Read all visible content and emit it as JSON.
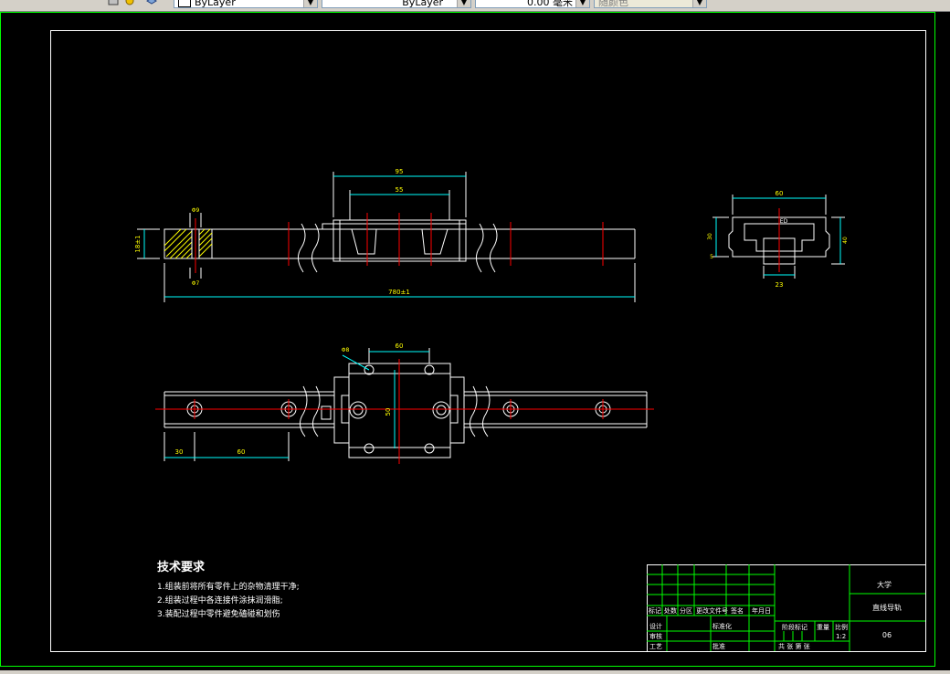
{
  "toolbar": {
    "color_combo": "ByLayer",
    "linetype_combo": "ByLayer",
    "lineweight_combo": "0.00 毫米",
    "plotstyle_combo": "随颜色"
  },
  "drawing": {
    "dims": {
      "top_outer_width": "95",
      "top_inner_width": "55",
      "rail_height": "18±1",
      "bolt_hole_dia": "Φ9",
      "bolt_hole_small": "Φ7",
      "rail_total_length": "780±1",
      "end_width": "60",
      "end_left_height": "30",
      "end_right_height": "40",
      "end_small": "5",
      "end_rail_width": "23",
      "end_label": "ED",
      "plan_width": "60",
      "plan_height": "50",
      "plan_hole": "Φ8",
      "plan_left_offset": "30",
      "plan_pitch": "60"
    },
    "tech_requirements": {
      "title": "技术要求",
      "items": [
        "1.组装前将所有零件上的杂物清理干净;",
        "2.组装过程中各连接件涂抹润滑脂;",
        "3.装配过程中零件避免磕碰和划伤"
      ]
    },
    "title_block": {
      "school": "大学",
      "part_name": "直线导轨",
      "drawing_no": "06",
      "scale_label": "比例",
      "scale_value": "1:2",
      "stage_mark": "阶段标记",
      "weight": "重量",
      "sheets": "共 张  第 张",
      "row_labels": {
        "mark": "标记",
        "count": "处数",
        "zone": "分区",
        "change_doc": "更改文件号",
        "sign": "签名",
        "date": "年月日",
        "design": "设计",
        "standardize": "标准化",
        "check": "审核",
        "process": "工艺",
        "approve": "批准"
      }
    }
  },
  "colors": {
    "canvas": "#000000",
    "line": "#ffffff",
    "red": "#ff0000",
    "green": "#00ff00",
    "cyan": "#00ffff",
    "yellow": "#ffff00"
  }
}
